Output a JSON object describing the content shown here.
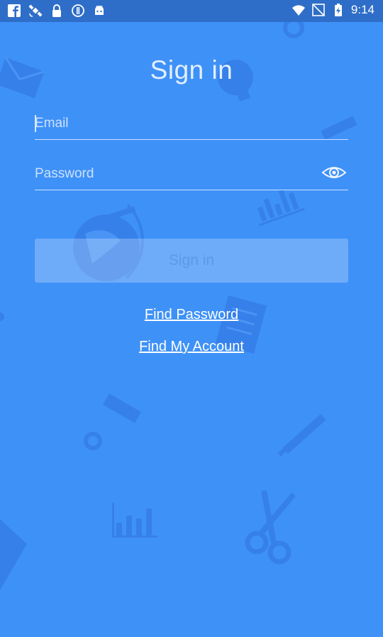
{
  "status_bar": {
    "time": "9:14",
    "left_icons": [
      "facebook-icon",
      "satellite-icon",
      "lock-icon",
      "info-circle-icon",
      "android-icon"
    ],
    "right_icons": [
      "wifi-icon",
      "no-signal-icon",
      "battery-charging-icon"
    ]
  },
  "screen": {
    "title": "Sign in",
    "email_placeholder": "Email",
    "password_placeholder": "Password",
    "sign_in_button": "Sign in",
    "find_password_link": "Find Password",
    "find_account_link": "Find My Account"
  },
  "colors": {
    "background": "#3e91f7",
    "status_bar": "#2e6ec8",
    "button_text": "#5c98e6"
  }
}
